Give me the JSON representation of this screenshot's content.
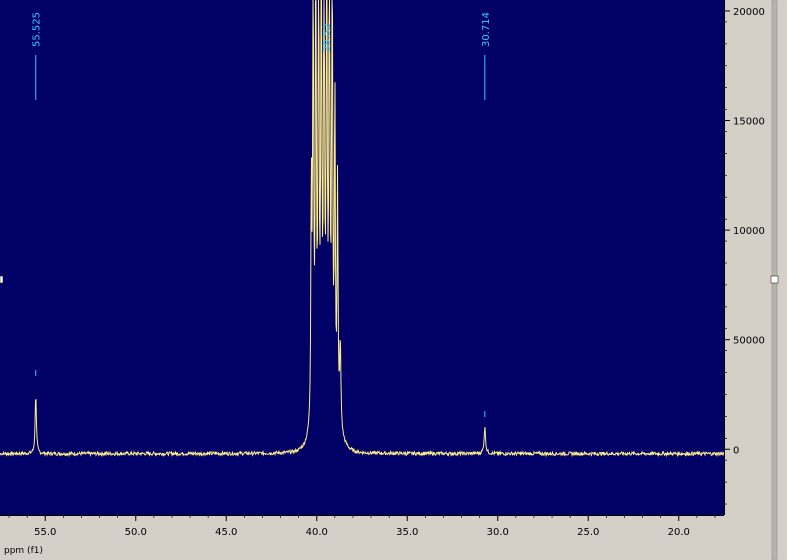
{
  "chart_data": {
    "type": "line",
    "xlabel": "ppm (f1)",
    "ylabel": "",
    "xlim": [
      57.5,
      17.5
    ],
    "ylim": [
      -30000,
      205000
    ],
    "x_ticks": [
      {
        "value": 55.0,
        "label": "55.0"
      },
      {
        "value": 50.0,
        "label": "50.0"
      },
      {
        "value": 45.0,
        "label": "45.0"
      },
      {
        "value": 40.0,
        "label": "40.0"
      },
      {
        "value": 35.0,
        "label": "35.0"
      },
      {
        "value": 30.0,
        "label": "30.0"
      },
      {
        "value": 25.0,
        "label": "25.0"
      },
      {
        "value": 20.0,
        "label": "20.0"
      }
    ],
    "y_ticks": [
      {
        "value": 200000,
        "label": "20000"
      },
      {
        "value": 150000,
        "label": "15000"
      },
      {
        "value": 100000,
        "label": "10000"
      },
      {
        "value": 50000,
        "label": "50000"
      },
      {
        "value": 0,
        "label": "0"
      }
    ],
    "series": [
      {
        "color": "#ffee88",
        "baseline": -2000,
        "peaks": [
          {
            "x": 55.525,
            "height": 28000,
            "width": 0.04
          },
          {
            "x": 30.714,
            "height": 12000,
            "width": 0.05
          },
          {
            "x": 40.3,
            "height": 110000,
            "width": 0.03
          },
          {
            "x": 40.2,
            "height": 230000,
            "width": 0.03
          },
          {
            "x": 40.05,
            "height": 240000,
            "width": 0.03
          },
          {
            "x": 39.9,
            "height": 240000,
            "width": 0.03
          },
          {
            "x": 39.75,
            "height": 240000,
            "width": 0.03
          },
          {
            "x": 39.6,
            "height": 240000,
            "width": 0.03
          },
          {
            "x": 39.45,
            "height": 240000,
            "width": 0.03
          },
          {
            "x": 39.3,
            "height": 240000,
            "width": 0.03
          },
          {
            "x": 39.15,
            "height": 240000,
            "width": 0.03
          },
          {
            "x": 39.0,
            "height": 150000,
            "width": 0.03
          },
          {
            "x": 38.85,
            "height": 110000,
            "width": 0.03
          },
          {
            "x": 38.7,
            "height": 40000,
            "width": 0.04
          }
        ]
      }
    ],
    "peak_labels": [
      {
        "x": 55.525,
        "label": "55.525"
      },
      {
        "x": 30.714,
        "label": "30.714"
      },
      {
        "x": 39.5,
        "label": "39.52"
      }
    ],
    "colors": {
      "background": "#000066",
      "frame_bg": "#d4d0c8",
      "spectrum": "#ffee88",
      "peak_label": "#33ccff"
    }
  }
}
